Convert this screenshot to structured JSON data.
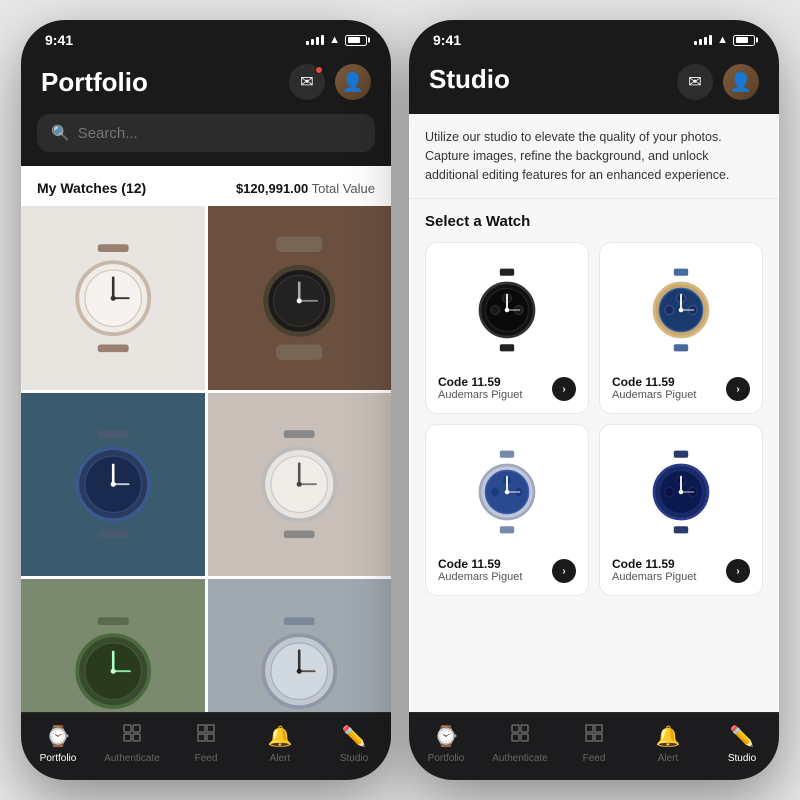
{
  "phone1": {
    "statusBar": {
      "time": "9:41",
      "signal": "●●●●",
      "wifi": "WiFi",
      "battery": "Battery"
    },
    "header": {
      "title": "Portfolio",
      "notificationIcon": "✉",
      "hasNotification": true
    },
    "search": {
      "placeholder": "Search..."
    },
    "portfolio": {
      "watchesLabel": "My Watches (12)",
      "totalValue": "$120,991.00",
      "totalValueSuffix": "Total Value"
    },
    "bottomNav": [
      {
        "id": "portfolio",
        "label": "Portfolio",
        "icon": "🕐",
        "active": true
      },
      {
        "id": "authenticate",
        "label": "Authenticate",
        "icon": "⊞",
        "active": false
      },
      {
        "id": "feed",
        "label": "Feed",
        "icon": "⊞",
        "active": false
      },
      {
        "id": "alert",
        "label": "Alert",
        "icon": "🦋",
        "active": false
      },
      {
        "id": "studio",
        "label": "Studio",
        "icon": "✏",
        "active": false
      }
    ]
  },
  "phone2": {
    "statusBar": {
      "time": "9:41"
    },
    "header": {
      "title": "Studio"
    },
    "description": "Utilize our studio to elevate the quality of your photos. Capture images, refine the background, and unlock additional editing features for an enhanced experience.",
    "selectWatchTitle": "Select a Watch",
    "watches": [
      {
        "id": 1,
        "name": "Code 11.59",
        "brand": "Audemars Piguet",
        "colorScheme": "dark"
      },
      {
        "id": 2,
        "name": "Code 11.59",
        "brand": "Audemars Piguet",
        "colorScheme": "blue-gold"
      },
      {
        "id": 3,
        "name": "Code 11.59",
        "brand": "Audemars Piguet",
        "colorScheme": "blue-steel"
      },
      {
        "id": 4,
        "name": "Code 11.59",
        "brand": "Audemars Piguet",
        "colorScheme": "navy"
      }
    ],
    "bottomNav": [
      {
        "id": "portfolio",
        "label": "Portfolio",
        "icon": "🕐",
        "active": false
      },
      {
        "id": "authenticate",
        "label": "Authenticate",
        "icon": "⊞",
        "active": false
      },
      {
        "id": "feed",
        "label": "Feed",
        "icon": "⊞",
        "active": false
      },
      {
        "id": "alert",
        "label": "Alert",
        "icon": "🦋",
        "active": false
      },
      {
        "id": "studio",
        "label": "Studio",
        "icon": "✏",
        "active": true
      }
    ]
  }
}
